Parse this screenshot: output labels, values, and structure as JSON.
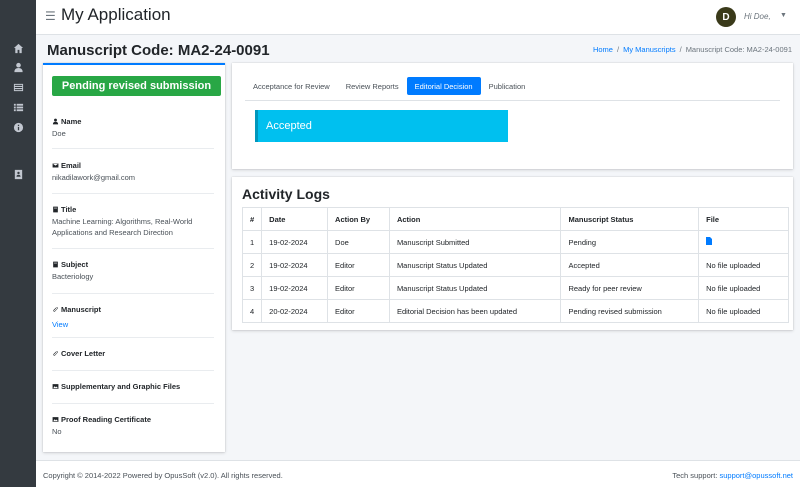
{
  "app": {
    "title": "My Application",
    "menu_icon": "hamburger-icon"
  },
  "user": {
    "initial": "D",
    "greeting": "Hi Doe,"
  },
  "sidebar": {
    "icons": [
      "home-icon",
      "user-icon",
      "list-alt-icon",
      "list-icon",
      "info-icon",
      "id-card-icon"
    ]
  },
  "page": {
    "title": "Manuscript Code: MA2-24-0091"
  },
  "breadcrumb": {
    "home": "Home",
    "manuscripts": "My Manuscripts",
    "current": "Manuscript Code: MA2-24-0091"
  },
  "manuscript": {
    "status_badge": "Pending revised submission",
    "fields": {
      "name": {
        "label": "Name",
        "value": "Doe"
      },
      "email": {
        "label": "Email",
        "value": "nikadilawork@gmail.com"
      },
      "title": {
        "label": "Title",
        "value": "Machine Learning: Algorithms, Real-World Applications and Research Direction"
      },
      "subject": {
        "label": "Subject",
        "value": "Bacteriology"
      },
      "manuscript": {
        "label": "Manuscript",
        "value": "View"
      },
      "cover_letter": {
        "label": "Cover Letter"
      },
      "supplementary": {
        "label": "Supplementary and Graphic Files"
      },
      "proof_reading": {
        "label": "Proof Reading Certificate",
        "value": "No"
      }
    }
  },
  "tabs": [
    {
      "label": "Acceptance for Review",
      "active": false
    },
    {
      "label": "Review Reports",
      "active": false
    },
    {
      "label": "Editorial Decision",
      "active": true
    },
    {
      "label": "Publication",
      "active": false
    }
  ],
  "decision": {
    "text": "Accepted",
    "color": "#00c0ef"
  },
  "activity_logs": {
    "title": "Activity Logs",
    "columns": [
      "#",
      "Date",
      "Action By",
      "Action",
      "Manuscript Status",
      "File"
    ],
    "rows": [
      {
        "num": "1",
        "date": "19-02-2024",
        "by": "Doe",
        "action": "Manuscript Submitted",
        "status": "Pending",
        "file": "",
        "has_file": true
      },
      {
        "num": "2",
        "date": "19-02-2024",
        "by": "Editor",
        "action": "Manuscript Status Updated",
        "status": "Accepted",
        "file": "No file uploaded",
        "has_file": false
      },
      {
        "num": "3",
        "date": "19-02-2024",
        "by": "Editor",
        "action": "Manuscript Status Updated",
        "status": "Ready for peer review",
        "file": "No file uploaded",
        "has_file": false
      },
      {
        "num": "4",
        "date": "20-02-2024",
        "by": "Editor",
        "action": "Editorial Decision has been updated",
        "status": "Pending revised submission",
        "file": "No file uploaded",
        "has_file": false
      }
    ]
  },
  "footer": {
    "copyright": "Copyright © 2014-2022 Powered by OpusSoft (v2.0). All rights reserved.",
    "support_label": "Tech support:",
    "support_email": "support@opussoft.net"
  },
  "colors": {
    "primary": "#007bff",
    "success": "#28a745",
    "info": "#00c0ef",
    "sidebar": "#343a40"
  }
}
